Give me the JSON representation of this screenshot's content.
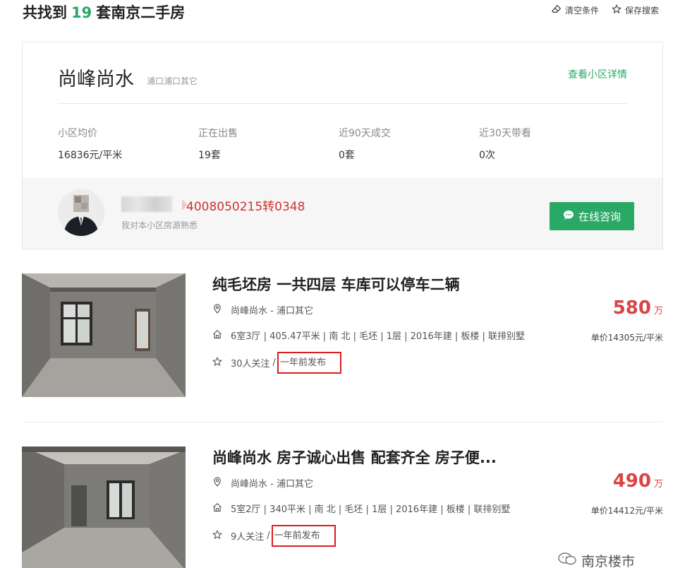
{
  "header": {
    "title_prefix": "共找到",
    "count": "19",
    "title_suffix": "套南京二手房",
    "clear_label": "清空条件",
    "save_label": "保存搜索"
  },
  "community": {
    "name": "尚峰尚水",
    "location": "浦口浦口其它",
    "detail_link": "查看小区详情",
    "stats": [
      {
        "label": "小区均价",
        "value": "16836元/平米"
      },
      {
        "label": "正在出售",
        "value": "19套"
      },
      {
        "label": "近90天成交",
        "value": "0套"
      },
      {
        "label": "近30天带看",
        "value": "0次"
      }
    ],
    "agent": {
      "phone": "4008050215转0348",
      "desc": "我对本小区房源熟悉",
      "consult_label": "在线咨询"
    }
  },
  "listings": [
    {
      "title": "纯毛坯房 一共四层 车库可以停车二辆",
      "location": "尚峰尚水 - 浦口其它",
      "info": "6室3厅 | 405.47平米 | 南 北 | 毛坯 | 1层 | 2016年建 | 板楼 | 联排别墅",
      "followers": "30人关注",
      "published": "一年前发布",
      "price": "580",
      "price_unit": "万",
      "unit_price": "单价14305元/平米"
    },
    {
      "title": "尚峰尚水 房子诚心出售 配套齐全 房子便...",
      "location": "尚峰尚水 - 浦口其它",
      "info": "5室2厅 | 340平米 | 南 北 | 毛坯 | 1层 | 2016年建 | 板楼 | 联排别墅",
      "followers": "9人关注",
      "published": "一年前发布",
      "price": "490",
      "price_unit": "万",
      "unit_price": "单价14412元/平米"
    }
  ],
  "watermark": "南京楼市",
  "colors": {
    "accent": "#2aa966",
    "price": "#d94444",
    "highlight_box": "#d81e1e"
  }
}
